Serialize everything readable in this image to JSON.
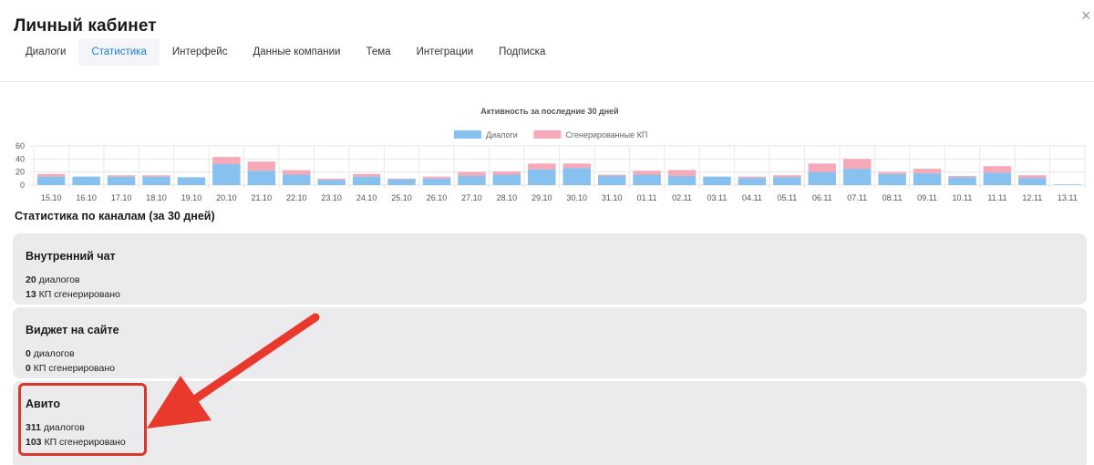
{
  "header": {
    "title": "Личный кабинет",
    "close_icon": "close-icon"
  },
  "tabs": [
    {
      "label": "Диалоги",
      "active": false
    },
    {
      "label": "Статистика",
      "active": true
    },
    {
      "label": "Интерфейс",
      "active": false
    },
    {
      "label": "Данные компании",
      "active": false
    },
    {
      "label": "Тема",
      "active": false
    },
    {
      "label": "Интеграции",
      "active": false
    },
    {
      "label": "Подписка",
      "active": false
    }
  ],
  "chart_data": {
    "type": "bar",
    "stacked": true,
    "title": "Активность за последние 30 дней",
    "legend_position": "top",
    "ylim": [
      0,
      60
    ],
    "yticks": [
      0,
      20,
      40,
      60
    ],
    "grid": true,
    "categories": [
      "15.10",
      "16.10",
      "17.10",
      "18.10",
      "19.10",
      "20.10",
      "21.10",
      "22.10",
      "23.10",
      "24.10",
      "25.10",
      "26.10",
      "27.10",
      "28.10",
      "29.10",
      "30.10",
      "31.10",
      "01.11",
      "02.11",
      "03.11",
      "04.11",
      "05.11",
      "06.11",
      "07.11",
      "08.11",
      "09.11",
      "10.11",
      "11.11",
      "12.11",
      "13.11"
    ],
    "series": [
      {
        "name": "Диалоги",
        "color": "#86c1ef",
        "values": [
          13,
          13,
          13,
          13,
          12,
          32,
          22,
          16,
          8,
          13,
          9,
          10,
          14,
          16,
          24,
          26,
          14,
          16,
          14,
          13,
          11,
          12,
          20,
          25,
          17,
          18,
          12,
          19,
          11,
          1
        ]
      },
      {
        "name": "Сгенерированные КП",
        "color": "#f6a9b8",
        "values": [
          4,
          0,
          2,
          2,
          0,
          11,
          14,
          7,
          2,
          4,
          1,
          3,
          6,
          5,
          9,
          7,
          2,
          6,
          9,
          0,
          2,
          3,
          13,
          15,
          3,
          7,
          2,
          10,
          4,
          0
        ]
      }
    ]
  },
  "channels": {
    "title": "Статистика по каналам (за 30 дней)",
    "items": [
      {
        "name": "Внутренний чат",
        "dialogs_count": "20",
        "dialogs_label": "диалогов",
        "kp_count": "13",
        "kp_label": "КП сгенерировано"
      },
      {
        "name": "Виджет на сайте",
        "dialogs_count": "0",
        "dialogs_label": "диалогов",
        "kp_count": "0",
        "kp_label": "КП сгенерировано"
      },
      {
        "name": "Авито",
        "dialogs_count": "311",
        "dialogs_label": "диалогов",
        "kp_count": "103",
        "kp_label": "КП сгенерировано"
      }
    ]
  },
  "annotation": {
    "highlight_color": "#d9382d"
  }
}
